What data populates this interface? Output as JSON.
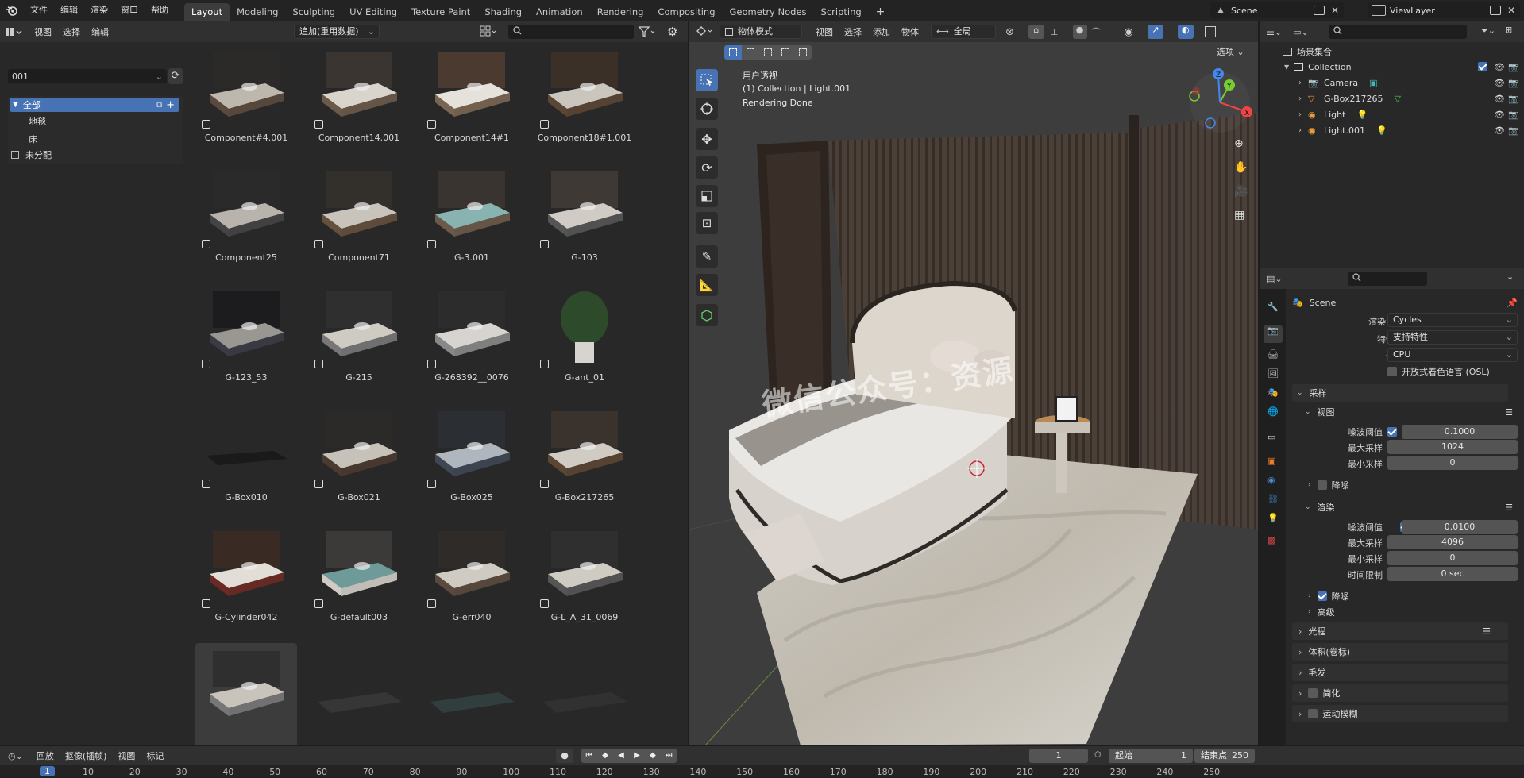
{
  "topbar": {
    "menus": [
      "文件",
      "编辑",
      "渲染",
      "窗口",
      "帮助"
    ],
    "workspaces": [
      "Layout",
      "Modeling",
      "Sculpting",
      "UV Editing",
      "Texture Paint",
      "Shading",
      "Animation",
      "Rendering",
      "Compositing",
      "Geometry Nodes",
      "Scripting"
    ],
    "active_workspace": "Layout",
    "add_tab": "+",
    "scene_name": "Scene",
    "view_layer": "ViewLayer"
  },
  "asset_browser": {
    "header_menus": [
      "视图",
      "选择",
      "编辑"
    ],
    "library": "追加(重用数据)",
    "catalog_value": "001",
    "catalogs": [
      {
        "label": "全部",
        "active": true
      },
      {
        "label": "地毯",
        "active": false
      },
      {
        "label": "床",
        "active": false
      },
      {
        "label": "未分配",
        "active": false
      }
    ],
    "assets": [
      "Component#4.001",
      "Component14.001",
      "Component14#1",
      "Component18#1.001",
      "Component25",
      "Component71",
      "G-3.001",
      "G-103",
      "G-123_53",
      "G-215",
      "G-268392__0076",
      "G-ant_01",
      "G-Box010",
      "G-Box021",
      "G-Box025",
      "G-Box217265",
      "G-Cylinder042",
      "G-default003",
      "G-err040",
      "G-L_A_31_0069",
      "",
      "",
      "",
      ""
    ]
  },
  "viewport": {
    "mode": "物体模式",
    "menus": [
      "视图",
      "选择",
      "添加",
      "物体"
    ],
    "transform": "全局",
    "options": "选项",
    "info_line1": "用户透视",
    "info_line2": "(1) Collection | Light.001",
    "info_line3": "Rendering Done",
    "watermark": "微信公众号：资源",
    "gizmo_x": "X",
    "gizmo_y": "Y",
    "gizmo_z": "Z"
  },
  "outliner": {
    "root": "场景集合",
    "collection": "Collection",
    "items": [
      "Camera",
      "G-Box217265",
      "Light",
      "Light.001"
    ]
  },
  "properties": {
    "scene": "Scene",
    "render_engine_label": "渲染引擎",
    "render_engine": "Cycles",
    "feature_set_label": "特性集",
    "feature_set": "支持特性",
    "device_label": "设备",
    "device": "CPU",
    "osl": "开放式着色语言 (OSL)",
    "sampling": "采样",
    "viewport_sub": "视图",
    "noise_threshold_label": "噪波阈值",
    "vp_noise_threshold": "0.1000",
    "max_samples_label": "最大采样",
    "vp_max_samples": "1024",
    "min_samples_label": "最小采样",
    "vp_min_samples": "0",
    "denoise": "降噪",
    "render_sub": "渲染",
    "r_noise_threshold": "0.0100",
    "r_max_samples": "4096",
    "r_min_samples": "0",
    "time_limit_label": "时间限制",
    "r_time_limit": "0 sec",
    "r_denoise": "降噪",
    "advanced": "高级",
    "light_paths": "光程",
    "volumes": "体积(卷标)",
    "hair": "毛发",
    "simplify": "简化",
    "motion_blur": "运动模糊"
  },
  "timeline": {
    "menus": [
      "回放",
      "抠像(插帧)",
      "视图",
      "标记"
    ],
    "current_frame": "1",
    "start_label": "起始",
    "start": "1",
    "end_label": "结束点",
    "end": "250",
    "ruler": [
      "1",
      "10",
      "20",
      "30",
      "40",
      "50",
      "60",
      "70",
      "80",
      "90",
      "100",
      "110",
      "120",
      "130",
      "140",
      "150",
      "160",
      "170",
      "180",
      "190",
      "200",
      "210",
      "220",
      "230",
      "240",
      "250"
    ]
  }
}
